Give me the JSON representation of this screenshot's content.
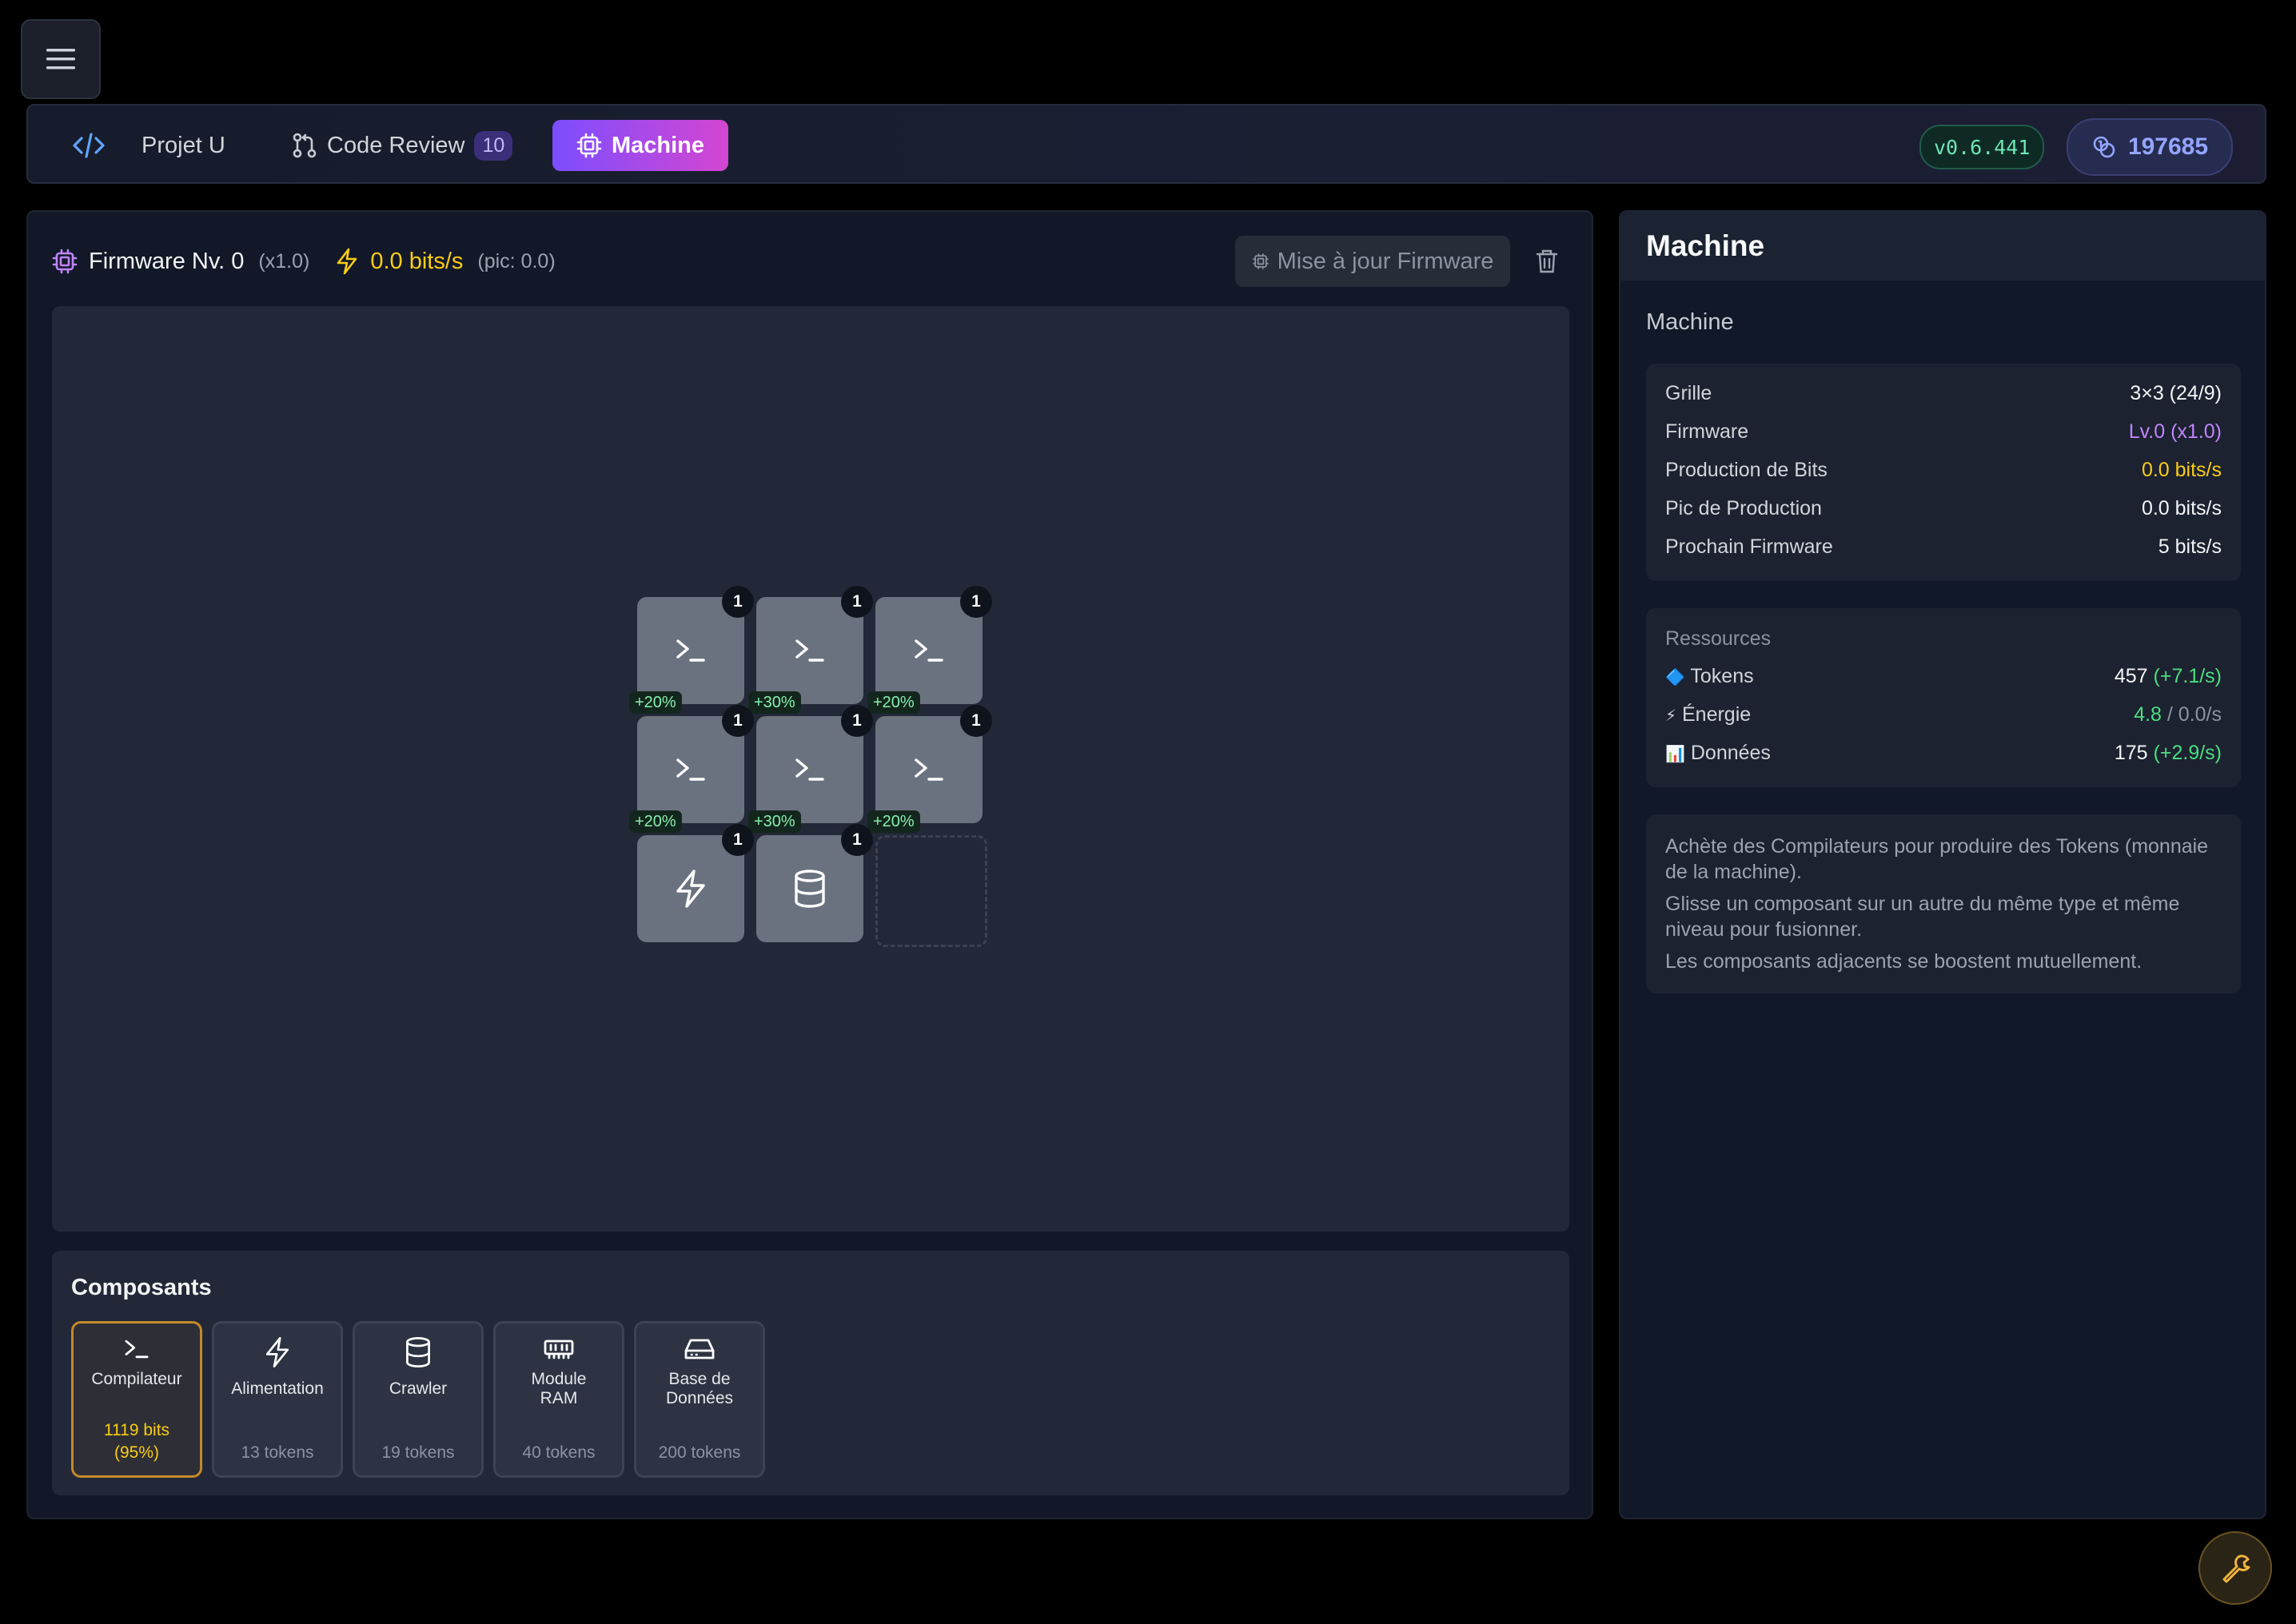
{
  "nav": {
    "project_label": "Projet U",
    "review_label": "Code Review",
    "review_count": "10",
    "machine_label": "Machine",
    "version": "v0.6.441",
    "token_total": "197685"
  },
  "firmware": {
    "title": "Firmware Nv. 0",
    "multiplier": "(x1.0)",
    "rate": "0.0 bits/s",
    "peak": "(pic: 0.0)",
    "upgrade_label": "Mise à jour Firmware"
  },
  "grid": {
    "cells": [
      {
        "type": "compiler",
        "level": "1",
        "boost": "+20%"
      },
      {
        "type": "compiler",
        "level": "1",
        "boost": "+30%"
      },
      {
        "type": "compiler",
        "level": "1",
        "boost": "+20%"
      },
      {
        "type": "compiler",
        "level": "1",
        "boost": "+20%"
      },
      {
        "type": "compiler",
        "level": "1",
        "boost": "+30%"
      },
      {
        "type": "compiler",
        "level": "1",
        "boost": "+20%"
      },
      {
        "type": "power",
        "level": "1",
        "boost": ""
      },
      {
        "type": "database",
        "level": "1",
        "boost": ""
      },
      {
        "type": "empty",
        "level": "",
        "boost": ""
      }
    ]
  },
  "components": {
    "title": "Composants",
    "items": [
      {
        "icon": "terminal-icon",
        "name": "Compilateur",
        "price": "1119 bits (95%)",
        "selected": true
      },
      {
        "icon": "bolt-icon",
        "name": "Alimentation",
        "price": "13 tokens",
        "selected": false
      },
      {
        "icon": "database-icon",
        "name": "Crawler",
        "price": "19 tokens",
        "selected": false
      },
      {
        "icon": "memory-icon",
        "name": "Module RAM",
        "price": "40 tokens",
        "selected": false
      },
      {
        "icon": "hard-drive-icon",
        "name": "Base de Données",
        "price": "200 tokens",
        "selected": false
      }
    ]
  },
  "side": {
    "header": "Machine",
    "subtitle": "Machine",
    "stats": [
      {
        "label": "Grille",
        "value": "3×3 (24/9)"
      },
      {
        "label": "Firmware",
        "value": "Lv.0 (x1.0)"
      },
      {
        "label": "Production de Bits",
        "value": "0.0 bits/s"
      },
      {
        "label": "Pic de Production",
        "value": "0.0 bits/s"
      },
      {
        "label": "Prochain Firmware",
        "value": "5 bits/s"
      }
    ],
    "resources_label": "Ressources",
    "resources": [
      {
        "icon": "🔷",
        "label": "Tokens",
        "value": "457",
        "delta": "(+7.1/s)"
      },
      {
        "icon": "⚡",
        "label": "Énergie",
        "value": "4.8",
        "delta": "/ 0.0/s"
      },
      {
        "icon": "📊",
        "label": "Données",
        "value": "175",
        "delta": "(+2.9/s)"
      }
    ],
    "help": [
      "Achète des Compilateurs pour produire des Tokens (monnaie de la machine).",
      "Glisse un composant sur un autre du même type et même niveau pour fusionner.",
      "Les composants adjacents se boostent mutuellement."
    ]
  },
  "colors": {
    "accent_gradient_start": "#7c4dff",
    "accent_gradient_end": "#d446d1",
    "rate_yellow": "#facc15",
    "boost_green": "#86efac",
    "firmware_purple": "#c084fc"
  }
}
